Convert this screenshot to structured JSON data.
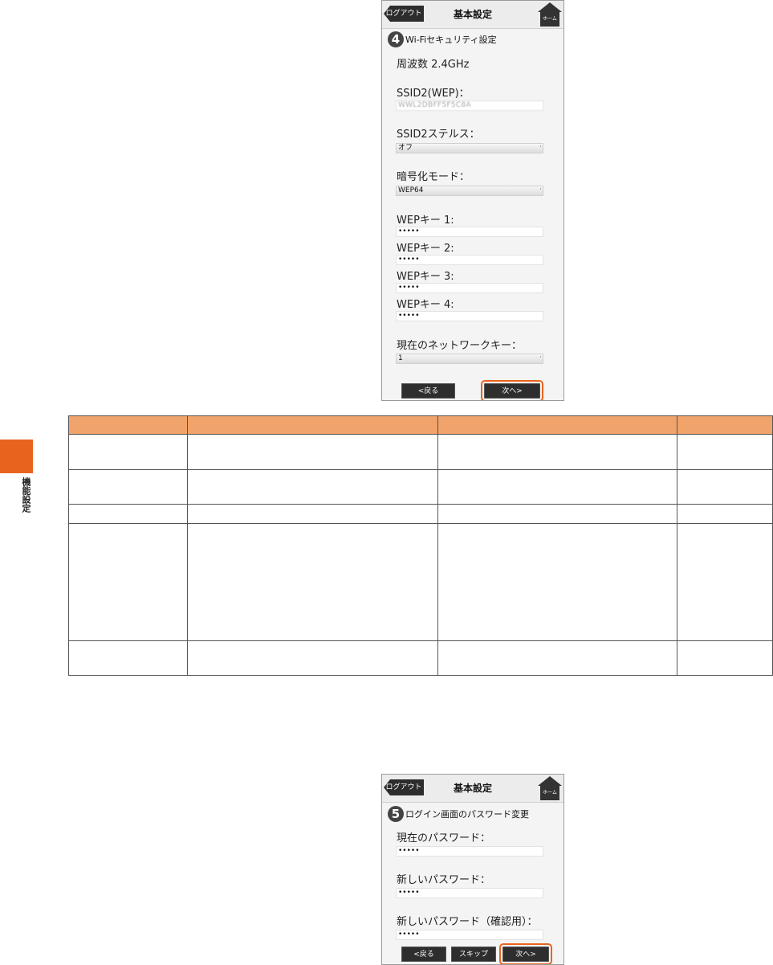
{
  "side": {
    "label": "機能設定"
  },
  "screen1": {
    "logout": "ログアウト",
    "title": "基本設定",
    "home": "ホーム",
    "step_number": "4",
    "step_title": "Wi-Fiセキュリティ設定",
    "frequency": "周波数 2.4GHz",
    "ssid_label": "SSID2(WEP)：",
    "ssid_value": "WWL2DBFF5F5C8A",
    "stealth_label": "SSID2ステルス：",
    "stealth_value": "オフ",
    "enc_label": "暗号化モード：",
    "enc_value": "WEP64",
    "wep1_label": "WEPキー 1:",
    "wep1_value": "•••••",
    "wep2_label": "WEPキー 2:",
    "wep2_value": "•••••",
    "wep3_label": "WEPキー 3:",
    "wep3_value": "•••••",
    "wep4_label": "WEPキー 4:",
    "wep4_value": "•••••",
    "netkey_label": "現在のネットワークキー：",
    "netkey_value": "1",
    "back": "<戻る",
    "next": "次へ>"
  },
  "screen2": {
    "logout": "ログアウト",
    "title": "基本設定",
    "home": "ホーム",
    "step_number": "5",
    "step_title": "ログイン画面のパスワード変更",
    "cur_pw_label": "現在のパスワード：",
    "cur_pw_value": "•••••",
    "new_pw_label": "新しいパスワード：",
    "new_pw_value": "•••••",
    "confirm_pw_label": "新しいパスワード（確認用）：",
    "confirm_pw_value": "•••••",
    "back": "<戻る",
    "skip": "スキップ",
    "next": "次へ>"
  },
  "table": {
    "rows": 5,
    "columns": 4
  }
}
